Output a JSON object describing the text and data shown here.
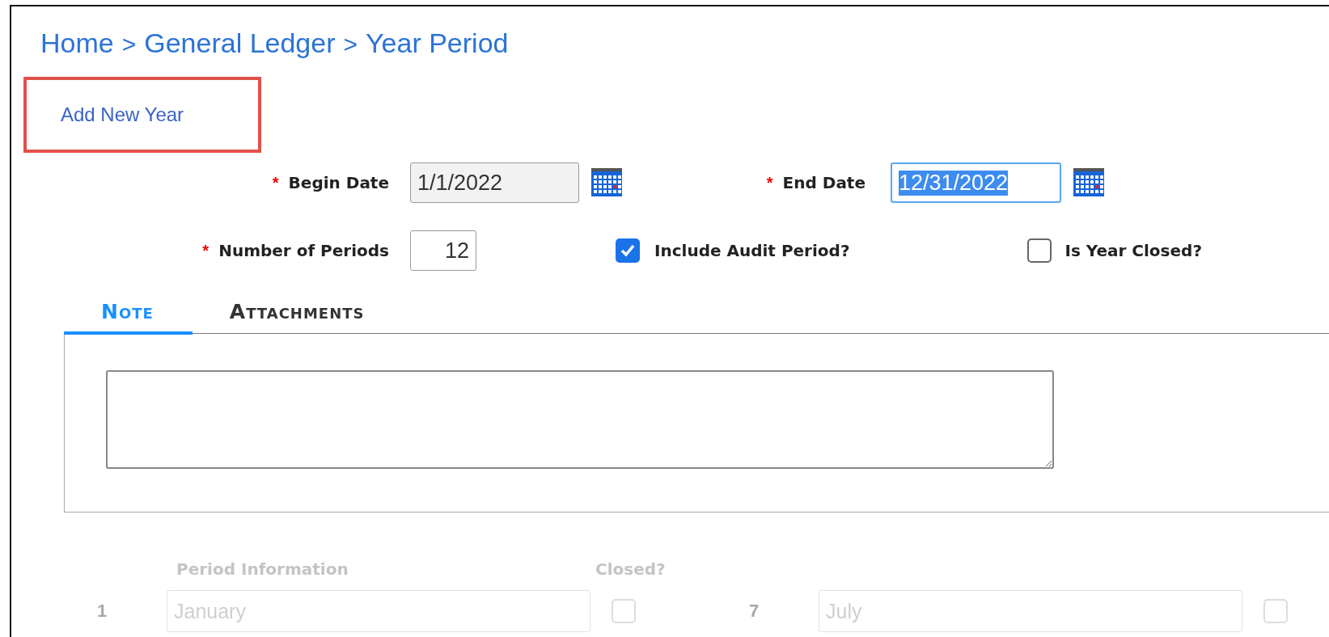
{
  "breadcrumb": {
    "separator": ">",
    "items": [
      "Home",
      "General Ledger",
      "Year Period"
    ]
  },
  "add_new_year": {
    "label": "Add New Year",
    "highlighted": true
  },
  "begin_date": {
    "required_mark": "*",
    "label": "Begin Date",
    "value": "1/1/2022",
    "readonly": true
  },
  "end_date": {
    "required_mark": "*",
    "label": "End Date",
    "value": "12/31/2022",
    "focused": true
  },
  "number_of_periods": {
    "required_mark": "*",
    "label": "Number of Periods",
    "value": "12"
  },
  "include_audit_period": {
    "label": "Include Audit Period?",
    "checked": true
  },
  "is_year_closed": {
    "label": "Is Year Closed?",
    "checked": false
  },
  "tabs": [
    {
      "label": "Note",
      "selected": true
    },
    {
      "label": "Attachments",
      "selected": false
    }
  ],
  "period_information": {
    "title": "Period Information",
    "closed_header": "Closed?",
    "disabled": true,
    "periods": [
      {
        "number": "1",
        "name": "January",
        "closed": false
      },
      {
        "number": "7",
        "name": "July",
        "closed": false
      }
    ]
  }
}
